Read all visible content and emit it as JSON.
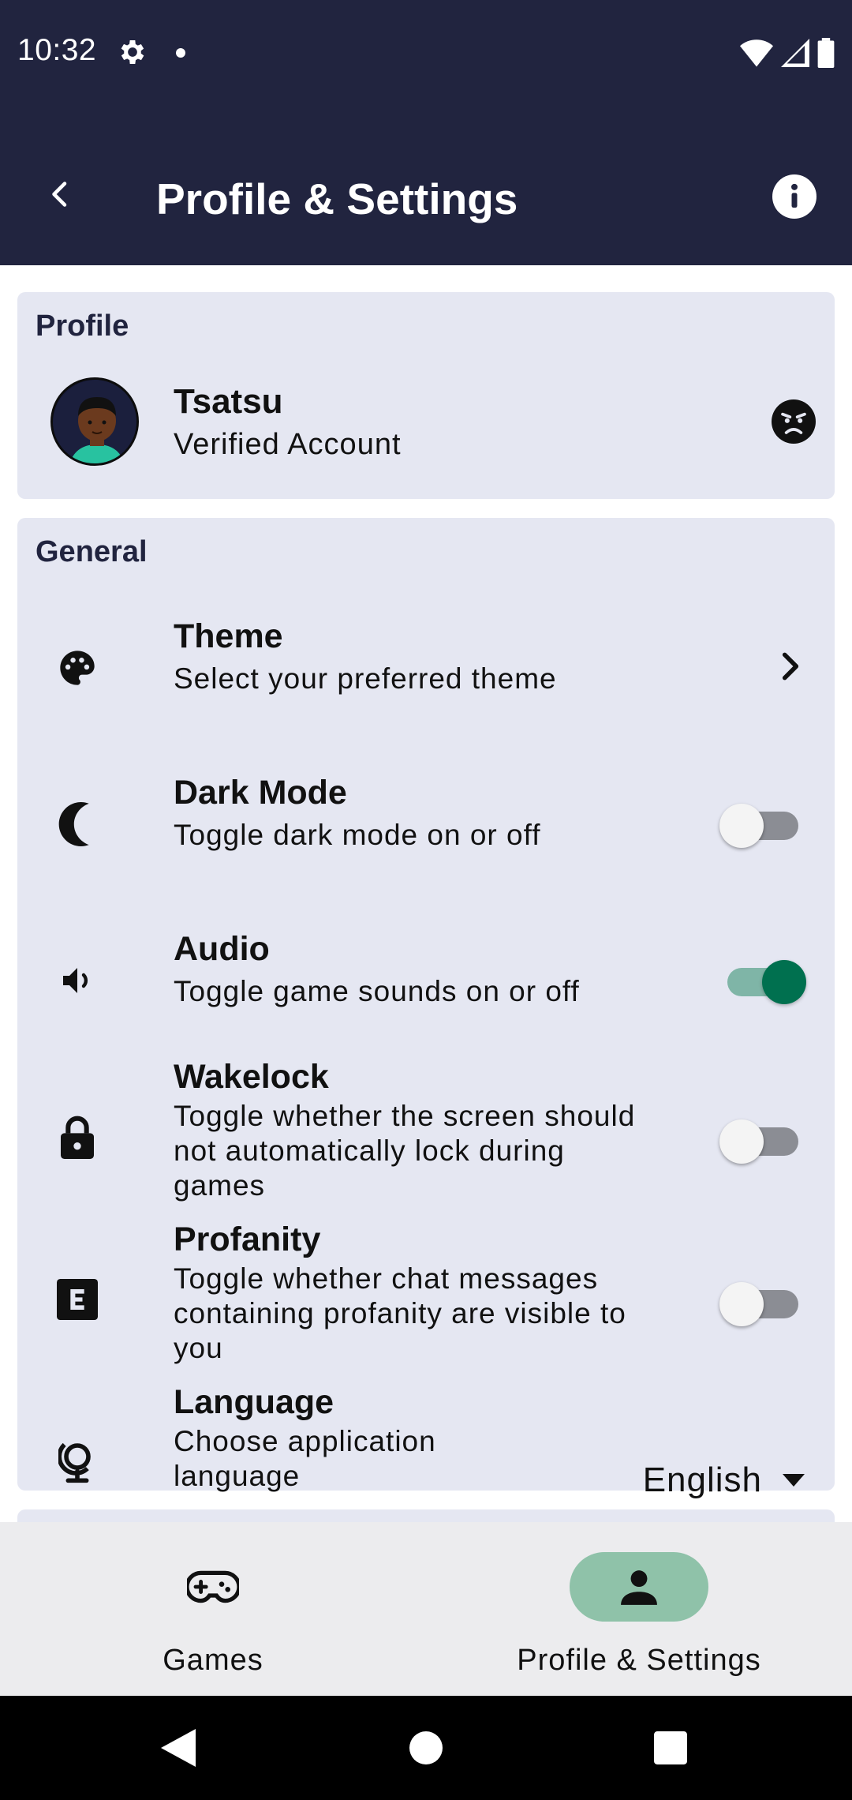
{
  "status_bar": {
    "time": "10:32"
  },
  "appbar": {
    "title": "Profile & Settings"
  },
  "profile": {
    "section_title": "Profile",
    "name": "Tsatsu",
    "subtitle": "Verified Account"
  },
  "general": {
    "section_title": "General",
    "settings": [
      {
        "title": "Theme",
        "description": "Select your preferred theme",
        "control": "chevron",
        "icon": "palette-icon"
      },
      {
        "title": "Dark Mode",
        "description": "Toggle dark mode on or off",
        "control": "switch",
        "on": false,
        "icon": "moon-icon"
      },
      {
        "title": "Audio",
        "description": "Toggle game sounds on or off",
        "control": "switch",
        "on": true,
        "icon": "speaker-icon"
      },
      {
        "title": "Wakelock",
        "description": "Toggle whether the screen should not automatically lock during games",
        "control": "switch",
        "on": false,
        "icon": "lock-icon"
      },
      {
        "title": "Profanity",
        "description": "Toggle whether chat messages containing profanity are visible to you",
        "control": "switch",
        "on": false,
        "icon": "explicit-icon"
      },
      {
        "title": "Language",
        "description": "Choose application language",
        "control": "dropdown",
        "value": "English",
        "icon": "globe-icon"
      }
    ]
  },
  "bottom_nav": {
    "items": [
      {
        "label": "Games",
        "icon": "gamepad-icon",
        "selected": false
      },
      {
        "label": "Profile & Settings",
        "icon": "person-icon",
        "selected": true
      }
    ]
  },
  "colors": {
    "appbar": "#21243f",
    "card": "#e5e7f2",
    "switch_on": "#00704f",
    "nav_selected": "#8fc2a9"
  }
}
